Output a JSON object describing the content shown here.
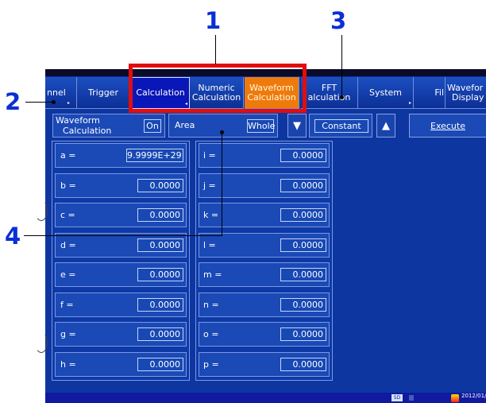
{
  "callouts": [
    "1",
    "2",
    "3",
    "4"
  ],
  "tabs": [
    {
      "label": "nnel",
      "arrow": true
    },
    {
      "label": "Trigger",
      "arrow": false
    },
    {
      "label": "Calculation",
      "arrow": true
    },
    {
      "label_line1": "Numeric",
      "label_line2": "Calculation"
    },
    {
      "label_line1": "Waveform",
      "label_line2": "Calculation"
    },
    {
      "label_line1": "FFT",
      "label_line2": "alculation"
    },
    {
      "label": "System",
      "arrow": true
    },
    {
      "label": "Fil"
    },
    {
      "label_line1": "Wavefor",
      "label_line2": "Display"
    }
  ],
  "controls": {
    "wave_calc_line1": "Waveform",
    "wave_calc_line2": "Calculation",
    "wave_calc_value": "On",
    "area_label": "Area",
    "area_value": "Whole",
    "down_symbol": "▼",
    "constant_label": "Constant",
    "up_symbol": "▲",
    "execute_label": "Execute"
  },
  "constants_left": [
    {
      "name": "a =",
      "value": "9.9999E+29"
    },
    {
      "name": "b =",
      "value": "0.0000"
    },
    {
      "name": "c =",
      "value": "0.0000"
    },
    {
      "name": "d =",
      "value": "0.0000"
    },
    {
      "name": "e =",
      "value": "0.0000"
    },
    {
      "name": "f =",
      "value": "0.0000"
    },
    {
      "name": "g =",
      "value": "0.0000"
    },
    {
      "name": "h =",
      "value": "0.0000"
    }
  ],
  "constants_right": [
    {
      "name": "i =",
      "value": "0.0000"
    },
    {
      "name": "j =",
      "value": "0.0000"
    },
    {
      "name": "k =",
      "value": "0.0000"
    },
    {
      "name": "l =",
      "value": "0.0000"
    },
    {
      "name": "m =",
      "value": "0.0000"
    },
    {
      "name": "n =",
      "value": "0.0000"
    },
    {
      "name": "o =",
      "value": "0.0000"
    },
    {
      "name": "p =",
      "value": "0.0000"
    }
  ],
  "status": {
    "sd": "SD",
    "date": "2012/01/"
  },
  "colors": {
    "screen_bg": "#0d36a0",
    "selected_tab": "#0a17b8",
    "orange_tab": "#ef7a0c",
    "callout_blue": "#0a2fd4",
    "highlight_red": "#e30d0d"
  }
}
